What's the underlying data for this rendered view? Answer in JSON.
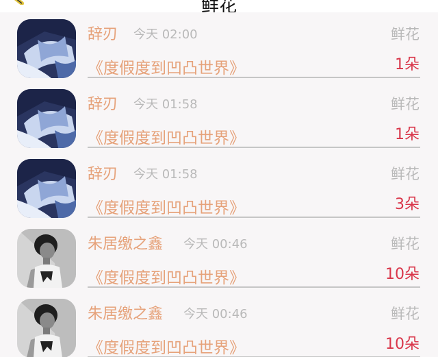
{
  "header": {
    "title": "鲜花"
  },
  "records": [
    {
      "name": "辞刃",
      "time": "今天 02:00",
      "gift_type": "鲜花",
      "book": "《度假度到凹凸世界》",
      "count": "1朵",
      "avatar": "anime-avatar"
    },
    {
      "name": "辞刃",
      "time": "今天 01:58",
      "gift_type": "鲜花",
      "book": "《度假度到凹凸世界》",
      "count": "1朵",
      "avatar": "anime-avatar"
    },
    {
      "name": "辞刃",
      "time": "今天 01:58",
      "gift_type": "鲜花",
      "book": "《度假度到凹凸世界》",
      "count": "3朵",
      "avatar": "anime-avatar"
    },
    {
      "name": "朱居缴之鑫",
      "time": "今天 00:46",
      "gift_type": "鲜花",
      "book": "《度假度到凹凸世界》",
      "count": "10朵",
      "avatar": "photo-avatar"
    },
    {
      "name": "朱居缴之鑫",
      "time": "今天 00:46",
      "gift_type": "鲜花",
      "book": "《度假度到凹凸世界》",
      "count": "10朵",
      "avatar": "photo-avatar"
    }
  ],
  "colors": {
    "name": "#e6a27a",
    "count": "#d9364a",
    "muted": "#b9b9b9",
    "list_bg": "#f8f6f7"
  }
}
